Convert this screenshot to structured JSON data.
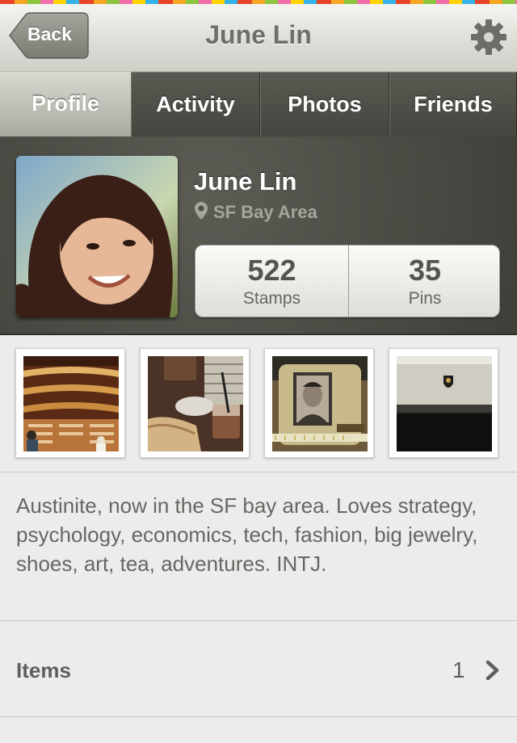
{
  "nav": {
    "back_label": "Back",
    "title": "June Lin",
    "settings_icon": "gear-icon"
  },
  "tabs": [
    {
      "label": "Profile",
      "active": true
    },
    {
      "label": "Activity",
      "active": false
    },
    {
      "label": "Photos",
      "active": false
    },
    {
      "label": "Friends",
      "active": false
    }
  ],
  "profile": {
    "name": "June Lin",
    "location": "SF Bay Area",
    "location_icon": "map-pin-icon",
    "stats": [
      {
        "value": "522",
        "label": "Stamps"
      },
      {
        "value": "35",
        "label": "Pins"
      }
    ]
  },
  "photos": {
    "thumbnails": [
      "theater-photo",
      "cafe-table-photo",
      "memorial-plaque-photo",
      "hallway-photo"
    ]
  },
  "bio": {
    "text": "Austinite, now in the SF bay area. Loves strategy, psychology, economics, tech, fashion, big jewelry, shoes, art, tea, adventures. INTJ."
  },
  "items": {
    "label": "Items",
    "count": "1",
    "chevron_icon": "chevron-right-icon"
  },
  "colors": {
    "header_bg": "#4a4a44",
    "tab_dark": "#4f4f49",
    "tab_active": "#c4c4bc",
    "text_gray": "#666662"
  }
}
